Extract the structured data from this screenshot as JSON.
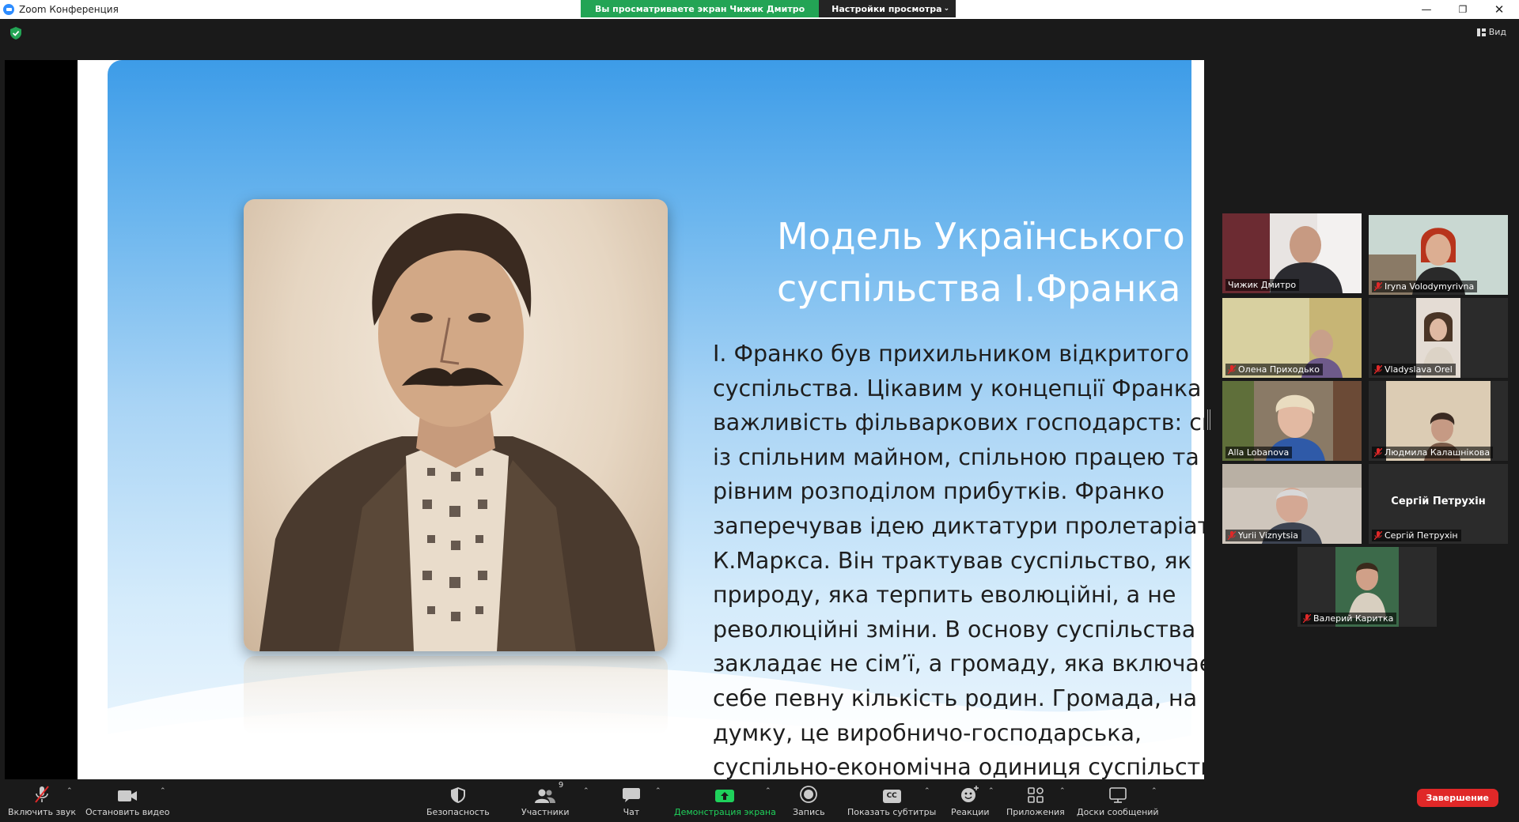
{
  "window": {
    "title": "Zoom Конференция",
    "share_banner": "Вы просматриваете экран Чижик Дмитро",
    "view_options": "Настройки просмотра",
    "view_button": "Вид"
  },
  "slide": {
    "title_line1": "Модель Українського",
    "title_line2": "суспільства І.Франка",
    "body": "І. Франко був прихильником відкритого суспільства. Цікавим у концепції  Франка є важливість фільваркових господарств: спілки із спільним майном, спільною працею та рівним розподілом прибутків. Франко заперечував ідею диктатури пролетаріату К.Маркса. Він трактував суспільство, як природу, яка терпить еволюційні, а не революційні зміни. В основу суспільства він закладає не сім’ї, а громаду, яка включає в себе певну кількість родин. Громада, на його думку, це виробничо-господарська, суспільно-економічна одиниця суспільства"
  },
  "participants": [
    {
      "name": "Чижик Дмитро",
      "muted": false,
      "active": true
    },
    {
      "name": "Iryna Volodymyrivna",
      "muted": true
    },
    {
      "name": "Олена Приходько",
      "muted": true
    },
    {
      "name": "Vladyslava Orel",
      "muted": true
    },
    {
      "name": "Alla Lobanova",
      "muted": false
    },
    {
      "name": "Людмила Калашнікова",
      "muted": true
    },
    {
      "name": "Yurii Viznytsia",
      "muted": true
    },
    {
      "name": "Сергій Петрухін",
      "muted": true,
      "camera_off_name": "Сергій Петрухін"
    },
    {
      "name": "Валерий Каритка",
      "muted": true
    }
  ],
  "toolbar": {
    "unmute": "Включить звук",
    "stop_video": "Остановить видео",
    "security": "Безопасность",
    "participants": "Участники",
    "participants_count": "9",
    "chat": "Чат",
    "share_screen": "Демонстрация экрана",
    "record": "Запись",
    "captions": "Показать субтитры",
    "captions_icon_text": "CC",
    "reactions": "Реакции",
    "apps": "Приложения",
    "whiteboards": "Доски сообщений",
    "end": "Завершение"
  },
  "colors": {
    "share_green": "#23a455",
    "active_speaker": "#d6e31f",
    "end_red": "#e02828",
    "share_label_green": "#1fd15b"
  }
}
